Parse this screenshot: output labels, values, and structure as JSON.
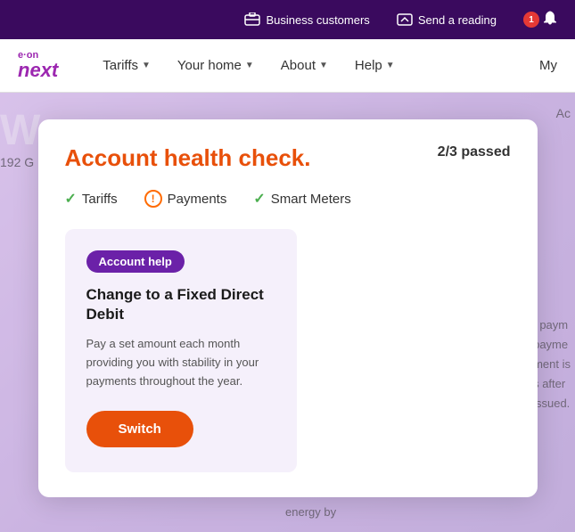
{
  "topBar": {
    "businessCustomers": "Business customers",
    "sendReading": "Send a reading",
    "notificationCount": "1"
  },
  "nav": {
    "logoEon": "e·on",
    "logoNext": "next",
    "tariffs": "Tariffs",
    "yourHome": "Your home",
    "about": "About",
    "help": "Help",
    "my": "My"
  },
  "modal": {
    "title": "Account health check.",
    "passed": "2/3 passed",
    "items": [
      {
        "label": "Tariffs",
        "status": "pass"
      },
      {
        "label": "Payments",
        "status": "warn"
      },
      {
        "label": "Smart Meters",
        "status": "pass"
      }
    ],
    "badge": "Account help",
    "cardTitle": "Change to a Fixed Direct Debit",
    "cardBody": "Pay a set amount each month providing you with stability in your payments throughout the year.",
    "switchBtn": "Switch"
  },
  "background": {
    "welcomeText": "W",
    "addressText": "192 G",
    "accountText": "Ac",
    "rightPaymText": "t paym",
    "rightLine1": "payme",
    "rightLine2": "ment is",
    "rightLine3": "s after",
    "rightLine4": "issued.",
    "energyText": "energy by"
  }
}
